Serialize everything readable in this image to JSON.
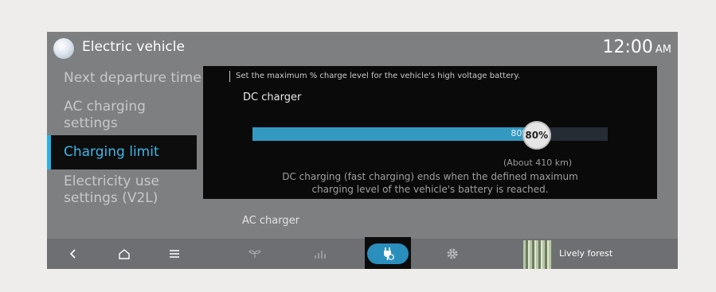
{
  "header": {
    "title": "Electric vehicle",
    "clock_time": "12:00",
    "clock_ampm": "AM",
    "app_icon": "globe-icon"
  },
  "sidebar": {
    "items": [
      {
        "label": "Next departure time"
      },
      {
        "label_line1": "AC charging",
        "label_line2": "settings"
      },
      {
        "label": "Charging limit",
        "active": true
      },
      {
        "label_line1": "Electricity use",
        "label_line2": "settings (V2L)"
      }
    ]
  },
  "panel": {
    "description": "Set the maximum % charge level for the vehicle's high voltage battery.",
    "dc": {
      "title": "DC charger",
      "limit_percent": 80,
      "bar_label": "80%",
      "knob_label": "80%",
      "range": "(About 410 km)",
      "note_line1": "DC charging (fast charging) ends when the defined maximum",
      "note_line2": "charging level of the vehicle's battery is reached."
    }
  },
  "ac": {
    "title": "AC charger"
  },
  "bottombar": {
    "icons": [
      "back-icon",
      "home-icon",
      "menu-icon",
      "sprout-icon",
      "bar-chart-icon",
      "ev-charging-icon",
      "gear-icon"
    ],
    "music_title": "Lively forest"
  },
  "colors": {
    "accent": "#2ab0e6",
    "bar_fill": "#3399c1",
    "panel_bg": "#0a0a0b",
    "screen_bg": "#7d7f81"
  }
}
